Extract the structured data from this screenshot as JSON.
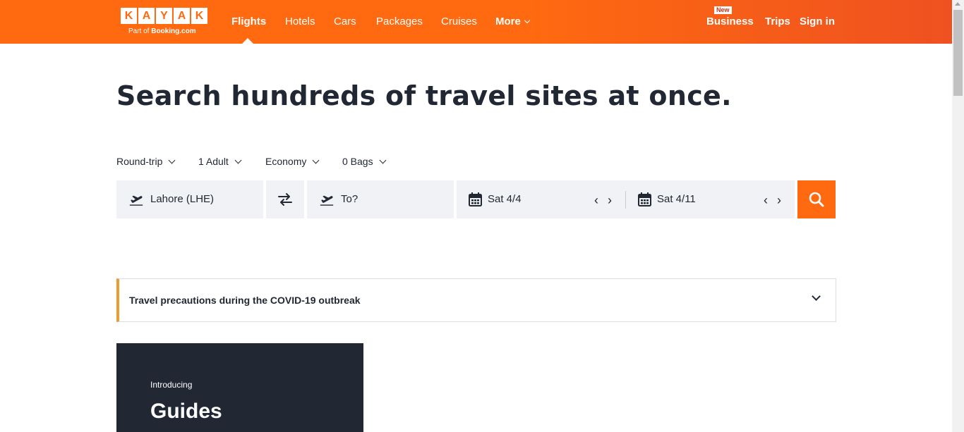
{
  "header": {
    "logo_letters": [
      "K",
      "A",
      "Y",
      "A",
      "K"
    ],
    "logo_sub_prefix": "Part of ",
    "logo_sub_brand": "Booking.com",
    "nav": {
      "flights": "Flights",
      "hotels": "Hotels",
      "cars": "Cars",
      "packages": "Packages",
      "cruises": "Cruises",
      "more": "More"
    },
    "new_badge": "New",
    "business": "Business",
    "trips": "Trips",
    "sign_in": "Sign in"
  },
  "headline": "Search hundreds of travel sites at once.",
  "options": {
    "trip_type": "Round-trip",
    "travelers": "1 Adult",
    "cabin": "Economy",
    "bags": "0 Bags"
  },
  "search": {
    "origin": "Lahore (LHE)",
    "destination_placeholder": "To?",
    "depart_date": "Sat 4/4",
    "return_date": "Sat 4/11"
  },
  "notice": {
    "text": "Travel precautions during the COVID-19 outbreak"
  },
  "guides": {
    "intro": "Introducing",
    "title": "Guides"
  },
  "colors": {
    "brand_orange": "#ff690f",
    "dark": "#212833",
    "notice_accent": "#ed9d2f"
  }
}
